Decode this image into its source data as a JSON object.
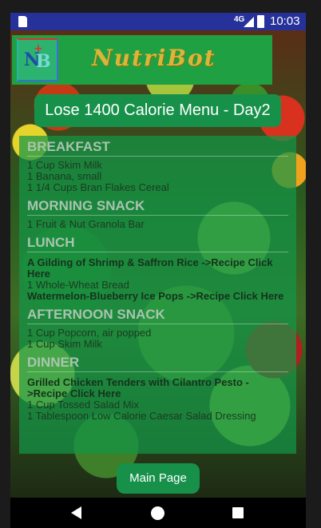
{
  "status_bar": {
    "network": "4G",
    "time": "10:03"
  },
  "header": {
    "app_title": "NutriBot",
    "logo_text": "NB"
  },
  "menu_title": "Lose 1400 Calorie Menu - Day2",
  "sections": [
    {
      "title": "BREAKFAST",
      "items": [
        {
          "text": "1 Cup Skim Milk",
          "recipe": false
        },
        {
          "text": "1 Banana, small",
          "recipe": false
        },
        {
          "text": "1 1/4 Cups Bran Flakes Cereal",
          "recipe": false
        }
      ]
    },
    {
      "title": "MORNING SNACK",
      "items": [
        {
          "text": "1 Fruit & Nut Granola Bar",
          "recipe": false
        }
      ]
    },
    {
      "title": "LUNCH",
      "items": [
        {
          "text": "A Gilding of Shrimp & Saffron Rice ->Recipe Click Here",
          "recipe": true
        },
        {
          "text": "1 Whole-Wheat Bread",
          "recipe": false
        },
        {
          "text": "Watermelon-Blueberry Ice Pops ->Recipe Click Here",
          "recipe": true
        }
      ]
    },
    {
      "title": "AFTERNOON SNACK",
      "items": [
        {
          "text": "1 Cup Popcorn, air popped",
          "recipe": false
        },
        {
          "text": "1 Cup Skim Milk",
          "recipe": false
        }
      ]
    },
    {
      "title": "DINNER",
      "items": [
        {
          "text": "Grilled Chicken Tenders with Cilantro Pesto ->Recipe Click Here",
          "recipe": true
        },
        {
          "text": "1 Cup Tossed Salad Mix",
          "recipe": false
        },
        {
          "text": "1 Tablespoon Low Calorie Caesar Salad Dressing",
          "recipe": false
        }
      ]
    }
  ],
  "main_button_label": "Main Page",
  "colors": {
    "status_bar": "#27319a",
    "header_green": "#1fa143",
    "button_green": "#17914a",
    "title_gold": "#d9b63a"
  }
}
